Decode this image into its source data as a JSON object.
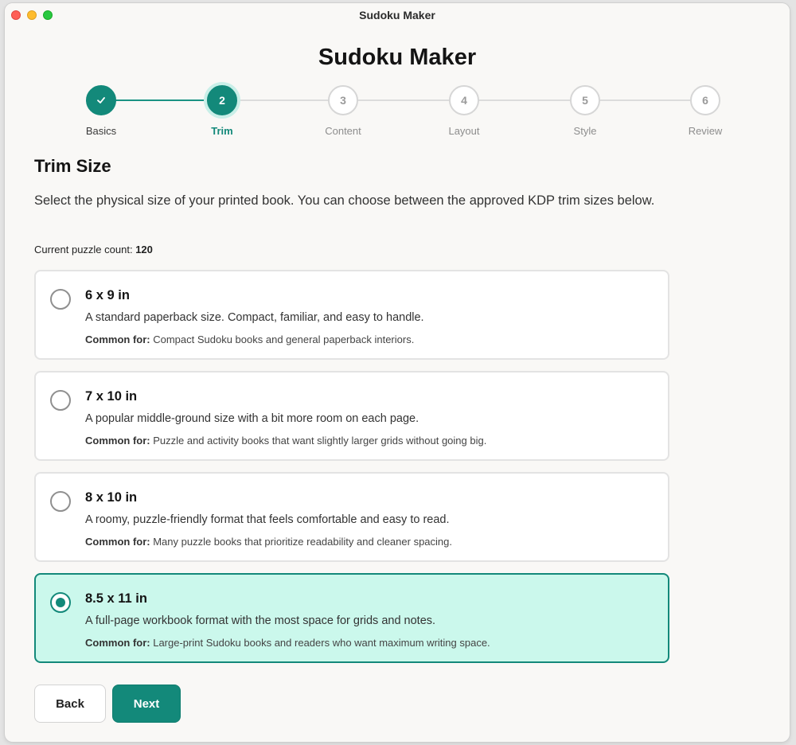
{
  "window": {
    "title": "Sudoku Maker"
  },
  "app": {
    "title": "Sudoku Maker"
  },
  "stepper": {
    "steps": [
      {
        "number": "1",
        "label": "Basics",
        "state": "done"
      },
      {
        "number": "2",
        "label": "Trim",
        "state": "active"
      },
      {
        "number": "3",
        "label": "Content",
        "state": "upcoming"
      },
      {
        "number": "4",
        "label": "Layout",
        "state": "upcoming"
      },
      {
        "number": "5",
        "label": "Style",
        "state": "upcoming"
      },
      {
        "number": "6",
        "label": "Review",
        "state": "upcoming"
      }
    ],
    "check_icon": "check-icon"
  },
  "section": {
    "title": "Trim Size",
    "description": "Select the physical size of your printed book. You can choose between the approved KDP trim sizes below.",
    "count_label": "Current puzzle count: ",
    "count_value": "120"
  },
  "options": [
    {
      "title": "6 x 9 in",
      "description": "A standard paperback size. Compact, familiar, and easy to handle.",
      "common_label": "Common for:",
      "common_text": " Compact Sudoku books and general paperback interiors.",
      "selected": false
    },
    {
      "title": "7 x 10 in",
      "description": "A popular middle-ground size with a bit more room on each page.",
      "common_label": "Common for:",
      "common_text": " Puzzle and activity books that want slightly larger grids without going big.",
      "selected": false
    },
    {
      "title": "8 x 10 in",
      "description": "A roomy, puzzle-friendly format that feels comfortable and easy to read.",
      "common_label": "Common for:",
      "common_text": " Many puzzle books that prioritize readability and cleaner spacing.",
      "selected": false
    },
    {
      "title": "8.5 x 11 in",
      "description": "A full-page workbook format with the most space for grids and notes.",
      "common_label": "Common for:",
      "common_text": " Large-print Sudoku books and readers who want maximum writing space.",
      "selected": true
    }
  ],
  "buttons": {
    "back": "Back",
    "next": "Next"
  },
  "colors": {
    "accent": "#13897a",
    "selected_bg": "#cbf8ec",
    "background": "#f9f8f6"
  }
}
